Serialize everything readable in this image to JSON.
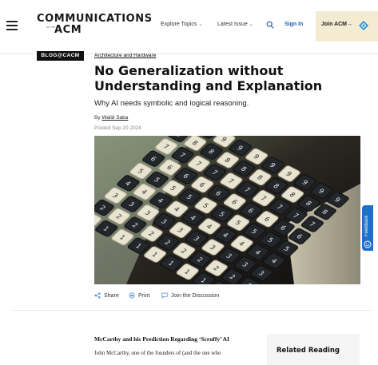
{
  "header": {
    "logo_line1": "COMMUNICATIONS",
    "logo_small": "OF THE",
    "logo_line2": "ACM",
    "nav": [
      {
        "label": "Explore Topics",
        "caret": "⌄"
      },
      {
        "label": "Latest Issue",
        "caret": "⌄"
      }
    ],
    "search_icon": "search-icon",
    "signin_label": "Sign In",
    "join_label": "Join ACM",
    "join_arrow": "→",
    "accent_color": "#1d60b3",
    "join_bg": "#f3ecd3"
  },
  "article": {
    "badge": "BLOG@CACM",
    "category": "Architecture and Hardware",
    "title": "No Generalization without Understanding and Explanation",
    "subtitle": "Why AI needs symbolic and logical reasoning.",
    "byline_prefix": "By ",
    "author": "Walid Saba",
    "posted": "Posted Sep 20 2024",
    "hero_image": "calculator keyboard photo"
  },
  "share": {
    "items": [
      {
        "label": "Share",
        "icon": "share-icon"
      },
      {
        "label": "Print",
        "icon": "print-icon"
      },
      {
        "label": "Join the Discussion",
        "icon": "comment-icon"
      }
    ]
  },
  "body": {
    "section_heading": "McCarthy and his Prediction Regarding ‘Scruffy’ AI",
    "paragraph_start": "John McCarthy, one of the founders of (and the one who"
  },
  "sidebar": {
    "related_title": "Related Reading"
  },
  "feedback": {
    "label": "Feedback",
    "color": "#1f6fd1"
  }
}
